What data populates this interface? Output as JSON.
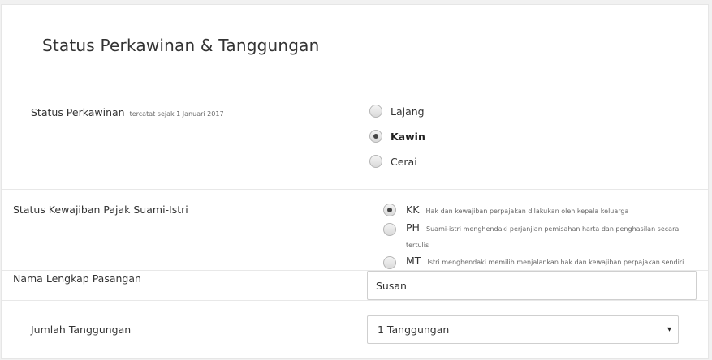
{
  "section": {
    "title": "Status Perkawinan & Tanggungan"
  },
  "status_perkawinan": {
    "label": "Status Perkawinan",
    "note": "tercatat sejak 1 Januari 2017",
    "options": [
      {
        "label": "Lajang",
        "checked": false
      },
      {
        "label": "Kawin",
        "checked": true
      },
      {
        "label": "Cerai",
        "checked": false
      }
    ]
  },
  "kewajiban_pajak": {
    "label": "Status Kewajiban Pajak Suami-Istri",
    "options": [
      {
        "code": "KK",
        "desc": "Hak dan kewajiban perpajakan dilakukan oleh kepala keluarga",
        "checked": true
      },
      {
        "code": "PH",
        "desc": "Suami-istri menghendaki perjanjian pemisahan harta dan penghasilan secara tertulis",
        "checked": false
      },
      {
        "code": "MT",
        "desc": "Istri menghendaki memilih menjalankan hak dan kewajiban perpajakan sendiri",
        "checked": false
      }
    ]
  },
  "nama_pasangan": {
    "label": "Nama Lengkap Pasangan",
    "value": "Susan"
  },
  "tanggungan": {
    "label": "Jumlah Tanggungan",
    "selected": "1 Tanggungan",
    "caret_icon": "▾"
  }
}
